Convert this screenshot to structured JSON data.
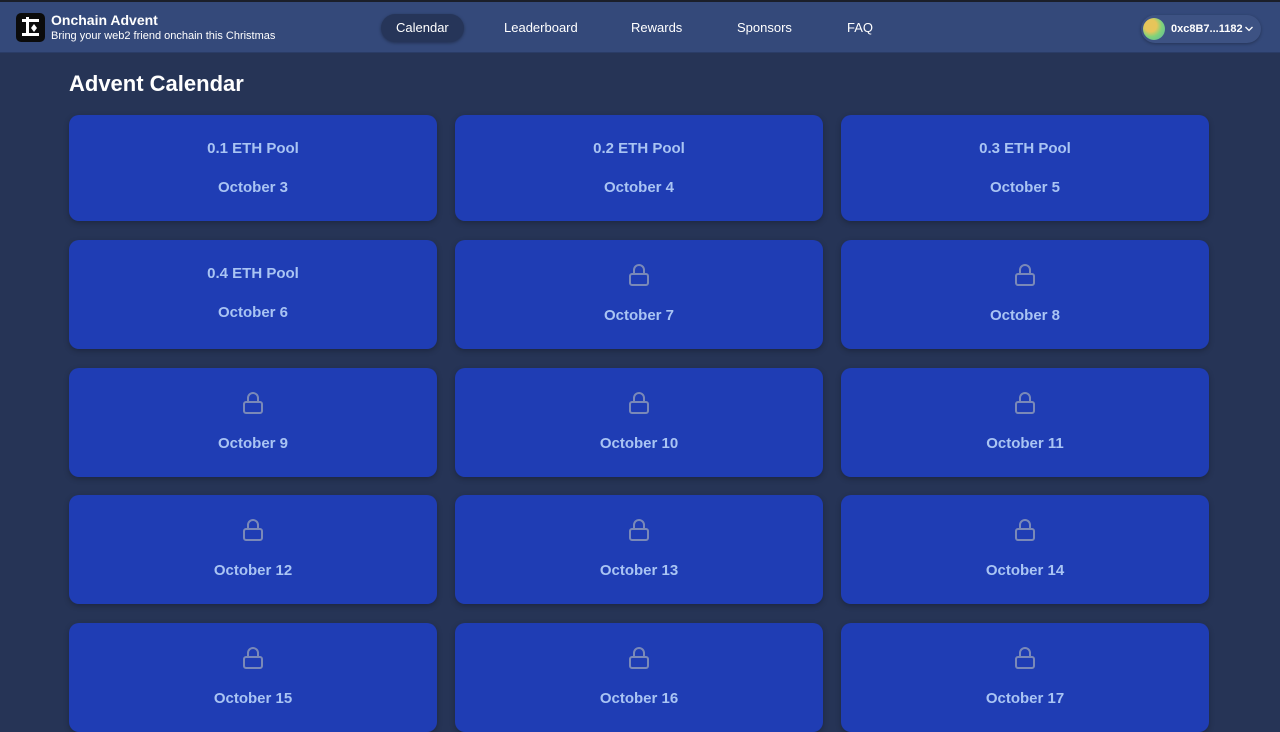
{
  "brand": {
    "title": "Onchain Advent",
    "subtitle": "Bring your web2 friend onchain this Christmas",
    "logo_icon": "tree-logo-icon"
  },
  "nav": {
    "items": [
      {
        "label": "Calendar",
        "active": true
      },
      {
        "label": "Leaderboard",
        "active": false
      },
      {
        "label": "Rewards",
        "active": false
      },
      {
        "label": "Sponsors",
        "active": false
      },
      {
        "label": "FAQ",
        "active": false
      }
    ]
  },
  "wallet": {
    "address": "0xc8B7...1182",
    "avatar_icon": "wallet-avatar",
    "chevron_icon": "chevron-down-icon"
  },
  "page": {
    "title": "Advent Calendar"
  },
  "calendar": {
    "days": [
      {
        "pool": "0.1 ETH Pool",
        "date": "October 3",
        "locked": false
      },
      {
        "pool": "0.2 ETH Pool",
        "date": "October 4",
        "locked": false
      },
      {
        "pool": "0.3 ETH Pool",
        "date": "October 5",
        "locked": false
      },
      {
        "pool": "0.4 ETH Pool",
        "date": "October 6",
        "locked": false
      },
      {
        "pool": "",
        "date": "October 7",
        "locked": true
      },
      {
        "pool": "",
        "date": "October 8",
        "locked": true
      },
      {
        "pool": "",
        "date": "October 9",
        "locked": true
      },
      {
        "pool": "",
        "date": "October 10",
        "locked": true
      },
      {
        "pool": "",
        "date": "October 11",
        "locked": true
      },
      {
        "pool": "",
        "date": "October 12",
        "locked": true
      },
      {
        "pool": "",
        "date": "October 13",
        "locked": true
      },
      {
        "pool": "",
        "date": "October 14",
        "locked": true
      },
      {
        "pool": "",
        "date": "October 15",
        "locked": true
      },
      {
        "pool": "",
        "date": "October 16",
        "locked": true
      },
      {
        "pool": "",
        "date": "October 17",
        "locked": true
      }
    ],
    "lock_icon": "lock-icon"
  },
  "colors": {
    "background": "#263456",
    "header": "#34497a",
    "card": "#1f3db4",
    "card_text": "#a9c4f3",
    "lock_stroke": "#7a89b8"
  }
}
